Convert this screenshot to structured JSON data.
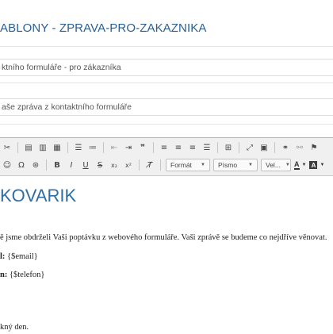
{
  "header": {
    "title": "ABLONY - ZPRAVA-PRO-ZAKAZNIKA"
  },
  "form": {
    "name_value": "ktního formuláře - pro zákazníka",
    "subject_value": "aše zpráva z kontaktního formuláře"
  },
  "toolbar": {
    "row1_icons": [
      "cut-icon",
      "paste-icon",
      "paste-text-icon",
      "paste-word-icon",
      "numbered-list-icon",
      "bulleted-list-icon",
      "outdent-icon",
      "indent-icon",
      "blockquote-icon",
      "align-left-icon",
      "align-center-icon",
      "align-right-icon",
      "align-justify-icon",
      "table-icon",
      "maximize-icon",
      "show-blocks-icon",
      "link-icon",
      "unlink-icon",
      "anchor-icon"
    ],
    "format_label": "Formát",
    "font_label": "Písmo",
    "size_label": "Vel...",
    "text_color_label": "A",
    "bg_color_label": "A"
  },
  "editor": {
    "heading": "KOVARIK",
    "intro": "ě jsme obdrželi Vaši poptávku z webového formuláře. Vaši zprávě se budeme co nejdříve věnovat.",
    "email_label": "l:",
    "email_value": "{$email}",
    "phone_label": "n:",
    "phone_value": "{$telefon}",
    "closing": "kný den."
  }
}
